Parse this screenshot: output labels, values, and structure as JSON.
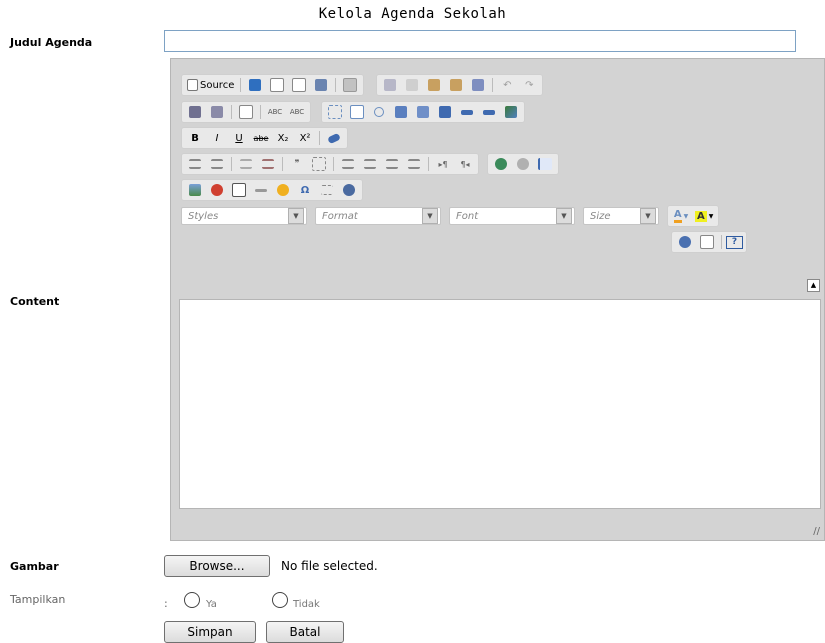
{
  "page_title": "Kelola Agenda Sekolah",
  "form": {
    "judul_label": "Judul Agenda",
    "judul_value": "",
    "content_label": "Content",
    "gambar_label": "Gambar",
    "browse_label": "Browse...",
    "file_status": "No file selected.",
    "tampilkan_label": "Tampilkan",
    "tampilkan_colon": ":",
    "radio_ya": "Ya",
    "radio_tidak": "Tidak",
    "simpan_label": "Simpan",
    "batal_label": "Batal"
  },
  "editor": {
    "source_label": "Source",
    "bold": "B",
    "italic": "I",
    "underline": "U",
    "strike": "abe",
    "subscript": "X₂",
    "superscript": "X²",
    "blockquote": "❞",
    "spell_a": "ABC",
    "spell_b": "ABC",
    "special_char": "Ω",
    "combos": {
      "styles": "Styles",
      "format": "Format",
      "font": "Font",
      "size": "Size"
    },
    "text_color": "A",
    "bg_color": "A",
    "about": "?",
    "resize_glyph": "//",
    "collapse_glyph": "▲",
    "content": ""
  }
}
